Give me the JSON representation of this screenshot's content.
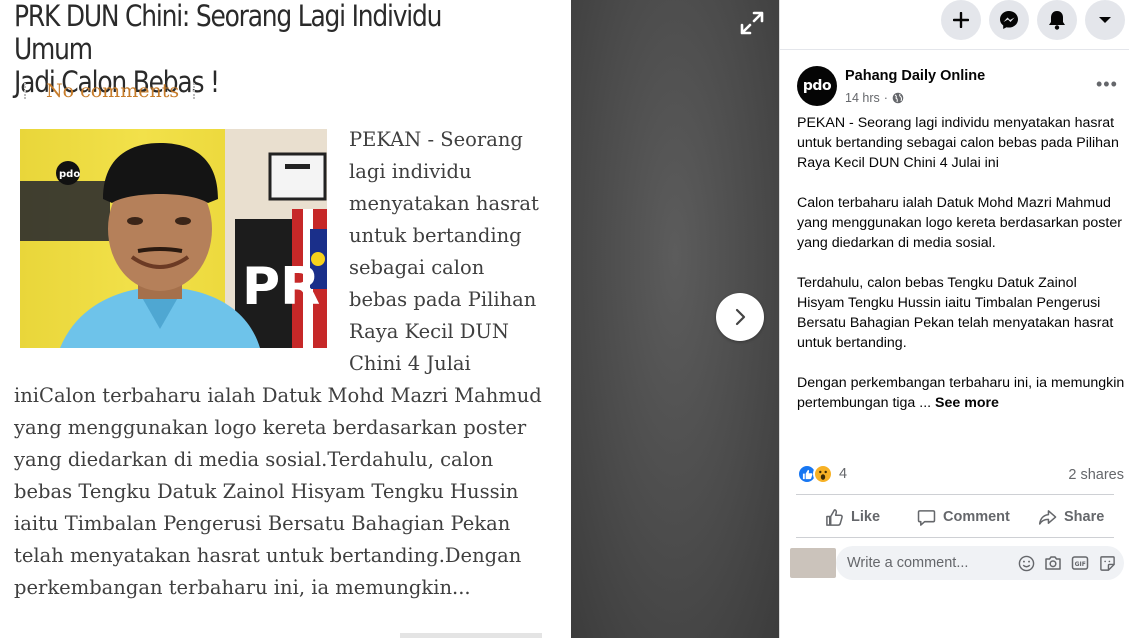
{
  "article": {
    "title": "PRK DUN Chini: Seorang Lagi Individu Umum\nJadi Calon Bebas !",
    "comments_link": "No comments",
    "body": "PEKAN - Seorang lagi individu menyatakan hasrat untuk bertanding sebagai calon bebas pada Pilihan Raya Kecil DUN Chini 4 Julai iniCalon terbaharu ialah Datuk Mohd Mazri Mahmud yang menggunakan logo kereta berdasarkan poster yang diedarkan di media sosial.Terdahulu, calon bebas Tengku Datuk Zainol Hisyam Tengku Hussin iaitu Timbalan Pengerusi Bersatu Bahagian Pekan telah menyatakan hasrat untuk bertanding.Dengan perkembangan terbaharu ini, ia memungkin...",
    "photo_logo": "pdo",
    "photo_sign": "PR"
  },
  "viewer": {
    "expand_icon": "expand-icon",
    "next_icon": "chevron-right-icon"
  },
  "topbar": {
    "buttons": [
      "plus-icon",
      "messenger-icon",
      "bell-icon",
      "caret-down-icon"
    ]
  },
  "post": {
    "avatar_text": "pdo",
    "page_name": "Pahang Daily Online",
    "time": "14 hrs",
    "audience_icon": "globe-icon",
    "paragraphs": [
      "PEKAN - Seorang lagi individu menyatakan hasrat untuk bertanding sebagai calon bebas pada Pilihan Raya Kecil DUN Chini 4 Julai ini",
      "Calon terbaharu ialah Datuk Mohd Mazri Mahmud yang menggunakan logo kereta berdasarkan poster yang diedarkan di media sosial.",
      "Terdahulu, calon bebas Tengku Datuk Zainol Hisyam Tengku Hussin iaitu Timbalan Pengerusi Bersatu Bahagian Pekan telah menyatakan hasrat untuk bertanding."
    ],
    "last_paragraph": "Dengan perkembangan terbaharu ini, ia memungkin pertembungan tiga ...",
    "see_more": "See more",
    "reaction_count": "4",
    "reactions": [
      "like-reaction",
      "wow-reaction"
    ],
    "shares": "2 shares",
    "actions": {
      "like": "Like",
      "comment": "Comment",
      "share": "Share"
    },
    "comment_placeholder": "Write a comment...",
    "comment_icons": [
      "emoji-icon",
      "camera-icon",
      "gif-icon",
      "sticker-icon"
    ]
  },
  "colors": {
    "accent": "#1877f2",
    "comments_link": "#c77c2a",
    "viewer_bg": "#4b4b4b"
  }
}
